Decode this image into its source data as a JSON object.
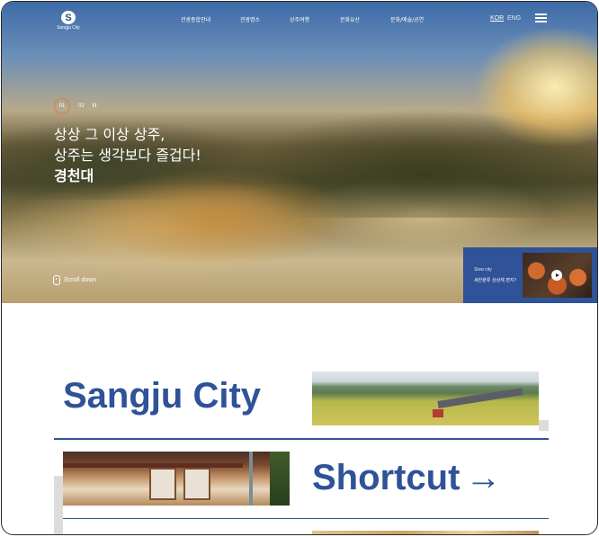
{
  "header": {
    "logo_text": "Sangju City",
    "nav": [
      "관광종합안내",
      "관광명소",
      "상주여행",
      "문화유산",
      "문화/예술/공연"
    ],
    "lang": {
      "kor": "KOR",
      "eng": "ENG"
    }
  },
  "hero": {
    "pager": {
      "current": "01",
      "next": "02",
      "pause": "II"
    },
    "headline": [
      "상상 그 이상 상주,",
      "상주는 생각보다 즐겁다!",
      "경천대"
    ],
    "scroll_label": "Scroll down",
    "video_card": {
      "caption1": "Slow city",
      "caption2": "세한분류 상상체 편지?"
    }
  },
  "sections": {
    "title1": "Sangju City",
    "title2": "Shortcut",
    "arrow": "→"
  },
  "colors": {
    "brand_blue": "#2f5298",
    "accent_orange": "#e07a4a"
  }
}
